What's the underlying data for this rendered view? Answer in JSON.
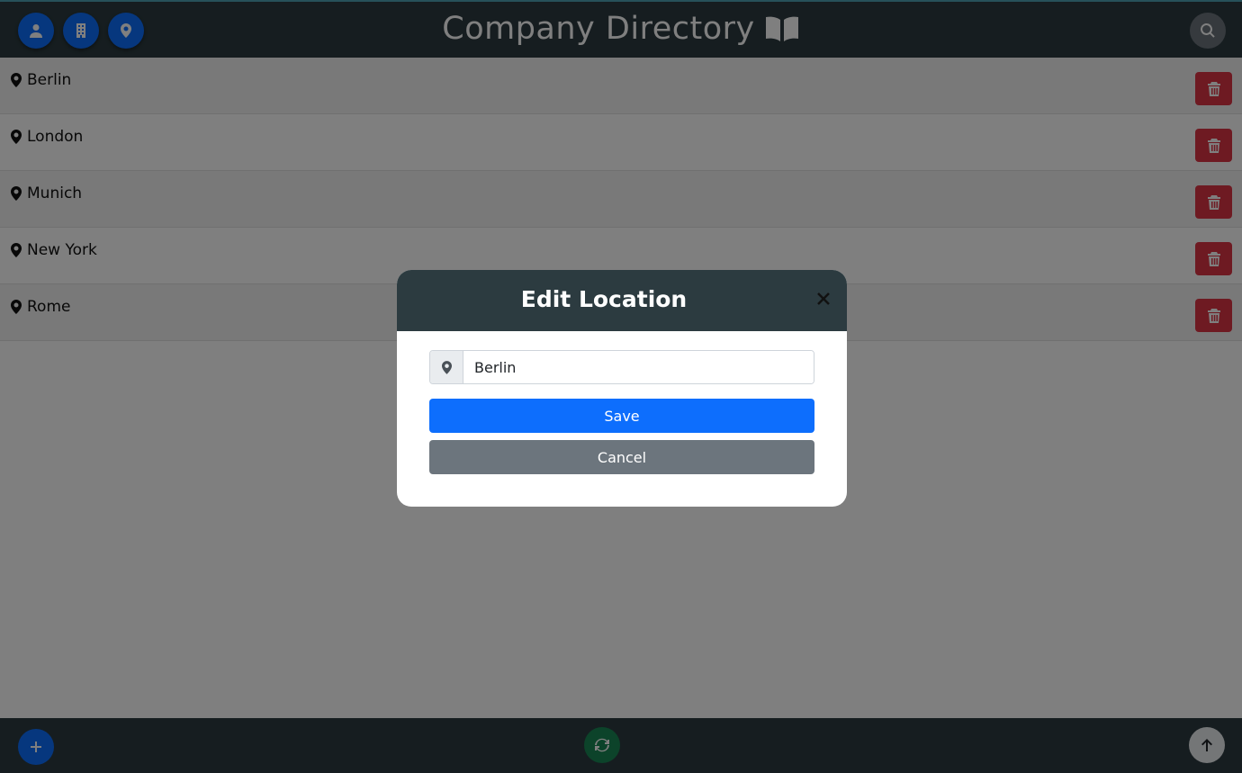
{
  "header": {
    "title": "Company Directory",
    "nav_buttons": [
      {
        "icon": "person-icon"
      },
      {
        "icon": "building-icon"
      },
      {
        "icon": "location-pin-icon"
      }
    ],
    "search_icon": "search-icon"
  },
  "locations": [
    {
      "name": "Berlin"
    },
    {
      "name": "London"
    },
    {
      "name": "Munich"
    },
    {
      "name": "New York"
    },
    {
      "name": "Rome"
    }
  ],
  "modal": {
    "title": "Edit Location",
    "input_value": "Berlin",
    "save_label": "Save",
    "cancel_label": "Cancel"
  },
  "footer": {
    "add_icon": "plus-icon",
    "refresh_icon": "refresh-icon",
    "top_icon": "arrow-up-icon"
  },
  "colors": {
    "header_bg": "#2c3b40",
    "primary": "#0d6efd",
    "danger": "#dc3545",
    "success": "#198754",
    "secondary": "#6c757d"
  }
}
